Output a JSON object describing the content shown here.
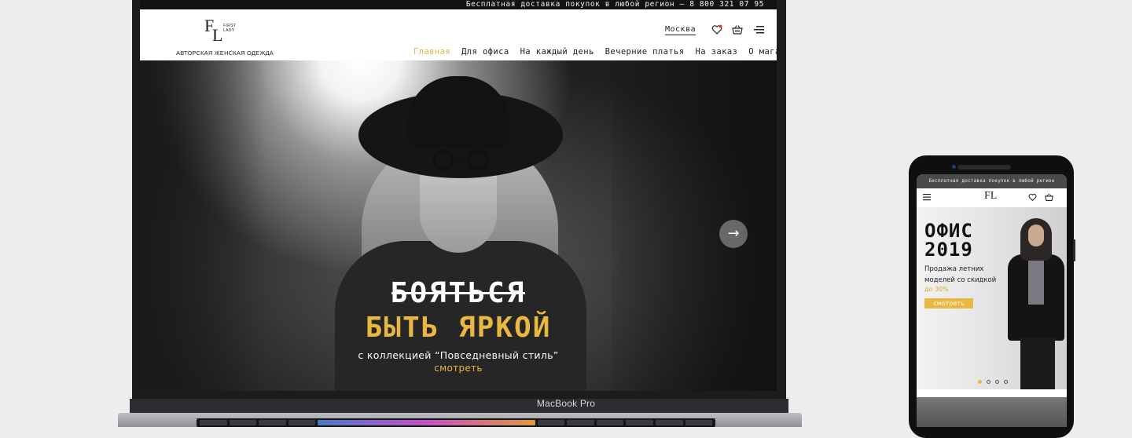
{
  "laptop": {
    "label": "MacBook Pro"
  },
  "site": {
    "promo": "Бесплатная доставка покупок в любой регион – 8 800 321 07 95",
    "logo": {
      "initial_f": "F",
      "initial_l": "L",
      "small_text_1": "FIRST",
      "small_text_2": "LADY"
    },
    "tagline": "АВТОРСКАЯ ЖЕНСКАЯ ОДЕЖДА",
    "city": "Москва",
    "nav": [
      "Главная",
      "Для офиса",
      "На каждый день",
      "Вечерние платья",
      "На заказ",
      "О магазине"
    ],
    "active_nav": "Главная",
    "icons": [
      "heart-icon",
      "cart-icon",
      "menu-icon"
    ],
    "accent_color": "#e8b840"
  },
  "hero": {
    "title_struck": "БОЯТЬСЯ",
    "title_main": "БЫТЬ ЯРКОЙ",
    "subtitle": "с коллекцией “Повседневный стиль”",
    "link": "смотреть",
    "next_arrow": "→"
  },
  "phone": {
    "promo": "Бесплатная доставка покупок в любой регион",
    "logo": "FL",
    "title_line1": "ОФИС",
    "title_line2": "2019",
    "text": "Продажа летних моделей со скидкой",
    "discount": "до 30%",
    "button": "смотреть",
    "slide_count": 4,
    "active_slide": 1
  }
}
